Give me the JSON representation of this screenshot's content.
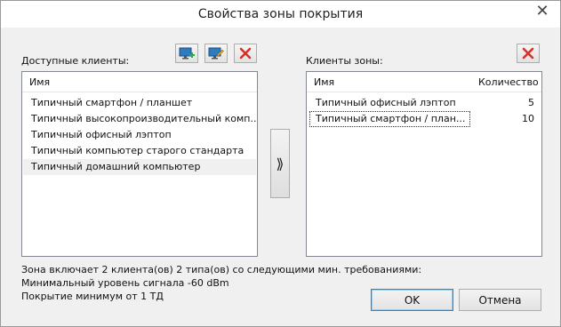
{
  "window": {
    "title": "Свойства зоны покрытия"
  },
  "left": {
    "label": "Доступные клиенты:",
    "column": "Имя",
    "items": [
      "Типичный смартфон / планшет",
      "Типичный высокопроизводительный комп...",
      "Типичный офисный лэптоп",
      "Типичный компьютер старого стандарта",
      "Типичный домашний компьютер"
    ],
    "selected_index": 4
  },
  "right": {
    "label": "Клиенты зоны:",
    "columns": [
      "Имя",
      "Количество"
    ],
    "rows": [
      {
        "name": "Типичный офисный лэптоп",
        "count": "5"
      },
      {
        "name": "Типичный смартфон / план...",
        "count": "10"
      }
    ]
  },
  "move_button": {
    "label": "⟫"
  },
  "info": {
    "line1": "Зона включает 2 клиента(ов) 2 типа(ов) со следующими мин. требованиями:",
    "line2": "Минимальный уровень сигнала -60 dBm",
    "line3": "Покрытие минимум от 1 ТД"
  },
  "buttons": {
    "ok": "OK",
    "cancel": "Отмена"
  },
  "icons": {
    "add": "monitor-add-icon",
    "edit": "monitor-edit-icon",
    "delete": "delete-x-icon",
    "close": "close-icon"
  },
  "colors": {
    "delete_red": "#d9302a",
    "monitor_blue": "#2f7bc0",
    "add_green": "#2da84a"
  }
}
